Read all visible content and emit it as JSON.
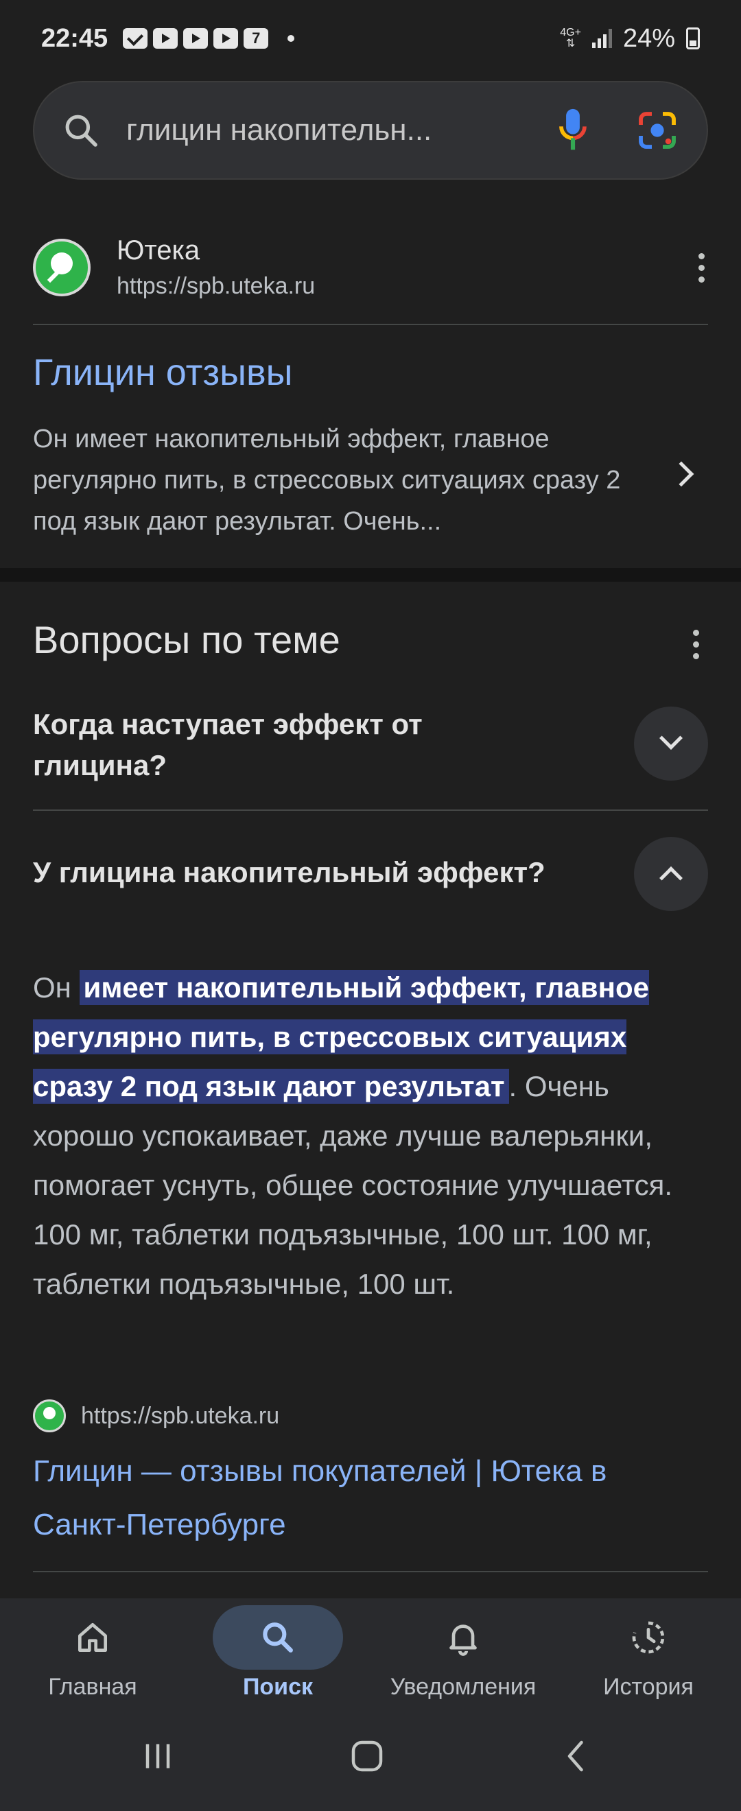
{
  "status_bar": {
    "time": "22:45",
    "network": "4G+",
    "battery": "24%"
  },
  "search": {
    "query": "глицин накопительн..."
  },
  "result": {
    "site_name": "Ютека",
    "url": "https://spb.uteka.ru",
    "title": "Глицин отзывы",
    "snippet": "Он имеет накопительный эффект, главное регулярно пить, в стрессовых ситуациях сразу 2 под язык дают результат. Очень..."
  },
  "related": {
    "heading": "Вопросы по теме",
    "questions": [
      {
        "text": "Когда наступает эффект от глицина?",
        "expanded": false
      },
      {
        "text": "У глицина накопительный эффект?",
        "expanded": true
      }
    ],
    "answer": {
      "prefix": "Он ",
      "highlight": "имеет накопительный эффект, главное регулярно пить, в стрессовых ситуациях сразу 2 под язык дают результат",
      "suffix": ". Очень хорошо успокаивает, даже лучше валерьянки, помогает уснуть, общее состояние улучшается. 100 мг, таблетки подъязычные, 100 шт. 100 мг, таблетки подъязычные, 100 шт.",
      "source_url": "https://spb.uteka.ru",
      "source_title": "Глицин — отзывы покупателей | Ютека в Санкт-Петербурге"
    }
  },
  "bottom_nav": [
    {
      "label": "Главная",
      "icon": "home-icon",
      "active": false
    },
    {
      "label": "Поиск",
      "icon": "search-icon",
      "active": true
    },
    {
      "label": "Уведомления",
      "icon": "bell-icon",
      "active": false
    },
    {
      "label": "История",
      "icon": "history-icon",
      "active": false
    }
  ],
  "colors": {
    "link": "#8ab4f8",
    "highlight_bg": "#2f3b7a",
    "background": "#1f1f1f"
  }
}
